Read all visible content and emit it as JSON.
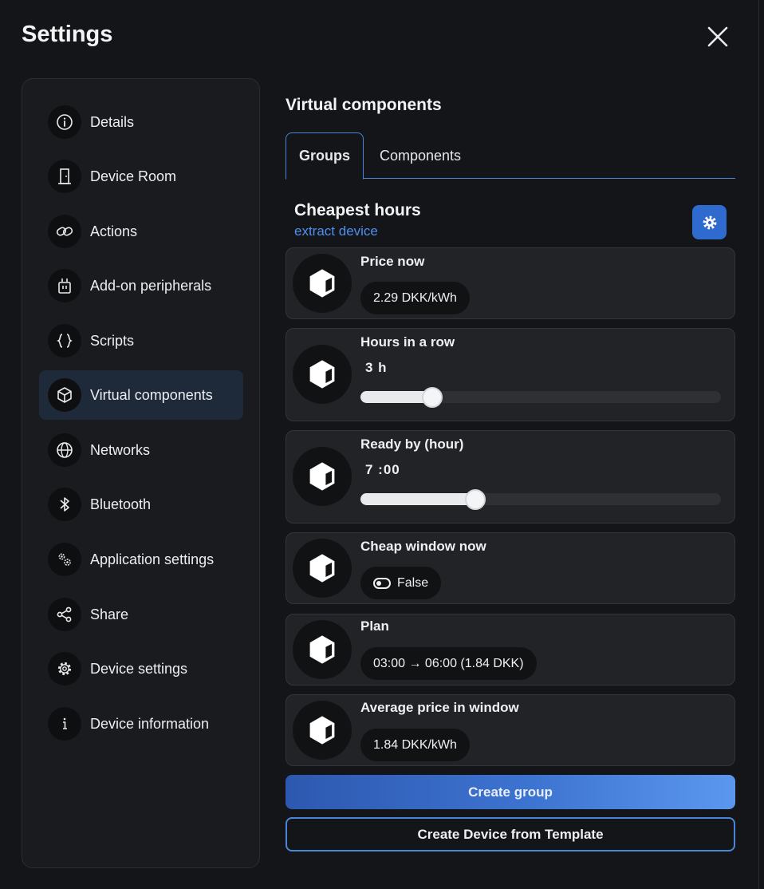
{
  "header": {
    "title": "Settings"
  },
  "sidebar": {
    "items": [
      {
        "label": "Details",
        "icon": "info-circle-icon"
      },
      {
        "label": "Device Room",
        "icon": "door-icon"
      },
      {
        "label": "Actions",
        "icon": "link-icon"
      },
      {
        "label": "Add-on peripherals",
        "icon": "peripheral-icon"
      },
      {
        "label": "Scripts",
        "icon": "braces-icon"
      },
      {
        "label": "Virtual components",
        "icon": "cube-icon",
        "active": true
      },
      {
        "label": "Networks",
        "icon": "globe-icon"
      },
      {
        "label": "Bluetooth",
        "icon": "bluetooth-icon"
      },
      {
        "label": "Application settings",
        "icon": "gears-icon"
      },
      {
        "label": "Share",
        "icon": "share-icon"
      },
      {
        "label": "Device settings",
        "icon": "gear-icon"
      },
      {
        "label": "Device information",
        "icon": "info-icon"
      }
    ]
  },
  "main": {
    "title": "Virtual components",
    "tabs": [
      {
        "label": "Groups",
        "active": true
      },
      {
        "label": "Components",
        "active": false
      }
    ],
    "group": {
      "title": "Cheapest hours",
      "subtitle": "extract device",
      "components": [
        {
          "title": "Price now",
          "kind": "value",
          "value": "2.29 DKK/kWh"
        },
        {
          "title": "Hours in a row",
          "kind": "slider",
          "value": "3 h",
          "level": 0.2
        },
        {
          "title": "Ready by (hour)",
          "kind": "slider",
          "value": "7 :00",
          "level": 0.318
        },
        {
          "title": "Cheap window now",
          "kind": "toggle",
          "value": "False"
        },
        {
          "title": "Plan",
          "kind": "value",
          "value": "03:00 → 06:00 (1.84 DKK)"
        },
        {
          "title": "Average price in window",
          "kind": "value",
          "value": "1.84 DKK/kWh"
        }
      ]
    },
    "buttons": {
      "create_group": "Create group",
      "create_from_template": "Create Device from Template"
    }
  },
  "colors": {
    "accent": "#4a86d8",
    "link": "#4f8ff0",
    "active_nav": "#1e2a3a",
    "background": "#141518",
    "card": "#222326"
  }
}
